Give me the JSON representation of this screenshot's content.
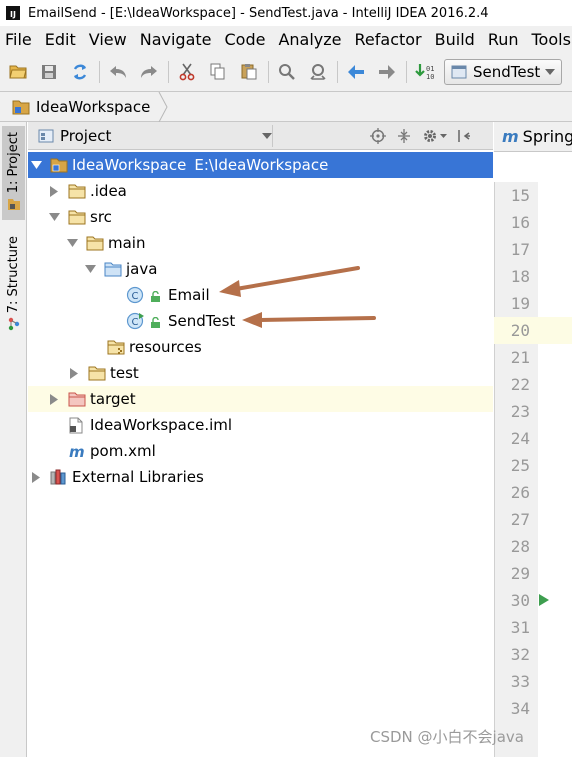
{
  "window": {
    "title": "EmailSend - [E:\\IdeaWorkspace] - SendTest.java - IntelliJ IDEA 2016.2.4",
    "app_icon": "IJ"
  },
  "menu": [
    "File",
    "Edit",
    "View",
    "Navigate",
    "Code",
    "Analyze",
    "Refactor",
    "Build",
    "Run",
    "Tools",
    "V"
  ],
  "toolbar": {
    "run_config": "SendTest"
  },
  "breadcrumb": {
    "project": "IdeaWorkspace"
  },
  "tool_strip": {
    "project_tab": "1: Project",
    "structure_tab": "7: Structure"
  },
  "project_panel": {
    "view_label": "Project"
  },
  "editor": {
    "tab_label": "Spring",
    "tab_glyph": "m",
    "line_numbers": [
      "15",
      "16",
      "17",
      "18",
      "19",
      "20",
      "21",
      "22",
      "23",
      "24",
      "25",
      "26",
      "27",
      "28",
      "29",
      "30",
      "31",
      "32",
      "33",
      "34"
    ]
  },
  "tree": {
    "root": {
      "name": "IdeaWorkspace",
      "path": "E:\\IdeaWorkspace"
    },
    "idea": ".idea",
    "src": "src",
    "main": "main",
    "java": "java",
    "email": "Email",
    "sendtest": "SendTest",
    "resources": "resources",
    "test": "test",
    "target": "target",
    "iml": "IdeaWorkspace.iml",
    "pom": "pom.xml",
    "external": "External Libraries"
  },
  "watermark": "CSDN @小白不会java",
  "colors": {
    "selection": "#3875d6",
    "folder": "#d7a546",
    "source_folder": "#6aa5d8",
    "excluded_folder": "#c9554b",
    "annotation_arrow": "#b5704a"
  }
}
